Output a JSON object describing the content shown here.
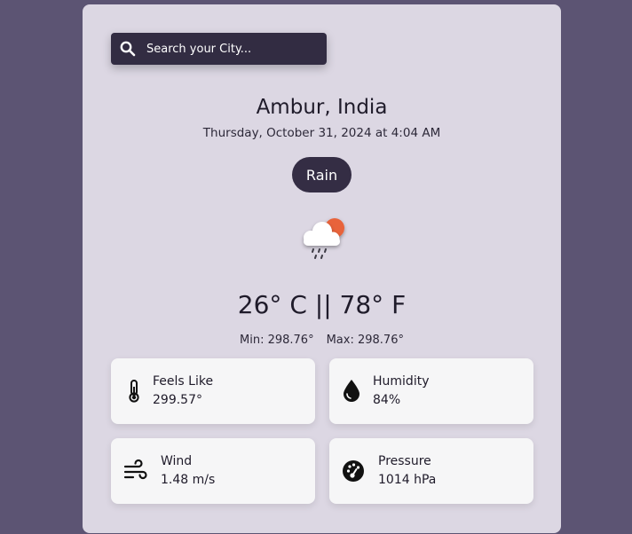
{
  "search": {
    "placeholder": "Search your City..."
  },
  "location": {
    "city": "Ambur, India",
    "datetime": "Thursday, October 31, 2024 at 4:04 AM"
  },
  "condition": {
    "label": "Rain",
    "icon": "rain-cloud-sun-icon"
  },
  "temperature": {
    "display": "26° C || 78° F"
  },
  "range": {
    "min": "Min: 298.76°",
    "max": "Max: 298.76°"
  },
  "stats": {
    "feels_like": {
      "label": "Feels Like",
      "value": "299.57°",
      "icon": "thermometer-icon"
    },
    "humidity": {
      "label": "Humidity",
      "value": "84%",
      "icon": "water-drop-icon"
    },
    "wind": {
      "label": "Wind",
      "value": "1.48 m/s",
      "icon": "wind-icon"
    },
    "pressure": {
      "label": "Pressure",
      "value": "1014 hPa",
      "icon": "gauge-icon"
    }
  },
  "colors": {
    "page_background": "#5c5473",
    "card_background": "#dcd7e3",
    "accent_dark": "#342d44",
    "tile_background": "#f6f6f7",
    "sun": "#e8643a"
  }
}
